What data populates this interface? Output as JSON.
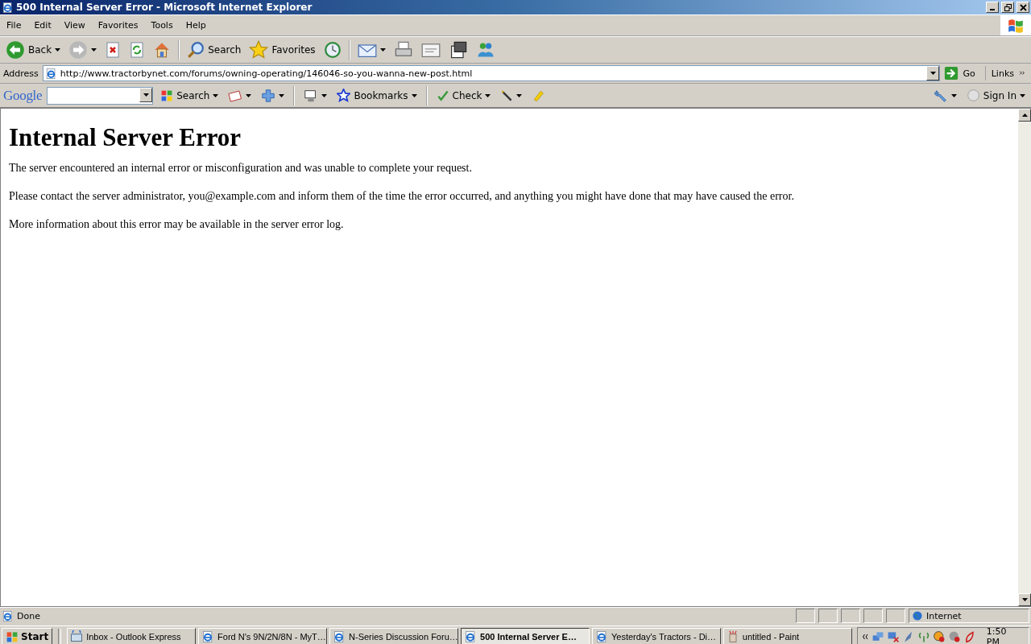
{
  "window": {
    "title": "500 Internal Server Error - Microsoft Internet Explorer"
  },
  "menu": [
    "File",
    "Edit",
    "View",
    "Favorites",
    "Tools",
    "Help"
  ],
  "toolbar": [
    {
      "kind": "back",
      "label": "Back",
      "dropdown": true
    },
    {
      "kind": "forward",
      "dropdown": true
    },
    {
      "kind": "stop"
    },
    {
      "kind": "refresh"
    },
    {
      "kind": "home"
    },
    {
      "kind": "search",
      "label": "Search"
    },
    {
      "kind": "favorites",
      "label": "Favorites"
    },
    {
      "kind": "history"
    },
    {
      "kind": "mail",
      "dropdown": true
    },
    {
      "kind": "print"
    },
    {
      "kind": "edit"
    },
    {
      "kind": "discuss"
    },
    {
      "kind": "messenger"
    }
  ],
  "address": {
    "label": "Address",
    "url": "http://www.tractorbynet.com/forums/owning-operating/146046-so-you-wanna-new-post.html",
    "go": "Go",
    "links": "Links"
  },
  "google_toolbar": {
    "logo": "Google",
    "items": [
      {
        "kind": "search",
        "label": "Search",
        "dropdown": true
      },
      {
        "kind": "popup",
        "dropdown": true
      },
      {
        "kind": "plus",
        "dropdown": true
      },
      {
        "kind": "pagerank",
        "dropdown": true
      },
      {
        "kind": "bookmarks",
        "label": "Bookmarks",
        "dropdown": true
      },
      {
        "kind": "check",
        "label": "Check",
        "dropdown": true
      },
      {
        "kind": "wand",
        "dropdown": true
      },
      {
        "kind": "highlight"
      }
    ],
    "right": [
      {
        "kind": "wrench",
        "dropdown": true
      },
      {
        "kind": "signin",
        "label": "Sign In",
        "dropdown": true
      }
    ]
  },
  "page": {
    "heading": "Internal Server Error",
    "paragraphs": [
      "The server encountered an internal error or misconfiguration and was unable to complete your request.",
      "Please contact the server administrator, you@example.com and inform them of the time the error occurred, and anything you might have done that may have caused the error.",
      "More information about this error may be available in the server error log."
    ]
  },
  "status_bar": {
    "text": "Done",
    "zone": "Internet"
  },
  "taskbar": {
    "start": "Start",
    "tasks": [
      {
        "kind": "outlook",
        "label": "Inbox - Outlook Express",
        "selected": false
      },
      {
        "kind": "ie",
        "label": "Ford N's 9N/2N/8N - MyT…",
        "selected": false
      },
      {
        "kind": "ie",
        "label": "N-Series Discussion Foru…",
        "selected": false
      },
      {
        "kind": "ie",
        "label": "500 Internal Server E…",
        "selected": true
      },
      {
        "kind": "ie",
        "label": "Yesterday's Tractors - Di…",
        "selected": false
      },
      {
        "kind": "paint",
        "label": "untitled - Paint",
        "selected": false
      }
    ],
    "clock": "1:50 PM"
  }
}
